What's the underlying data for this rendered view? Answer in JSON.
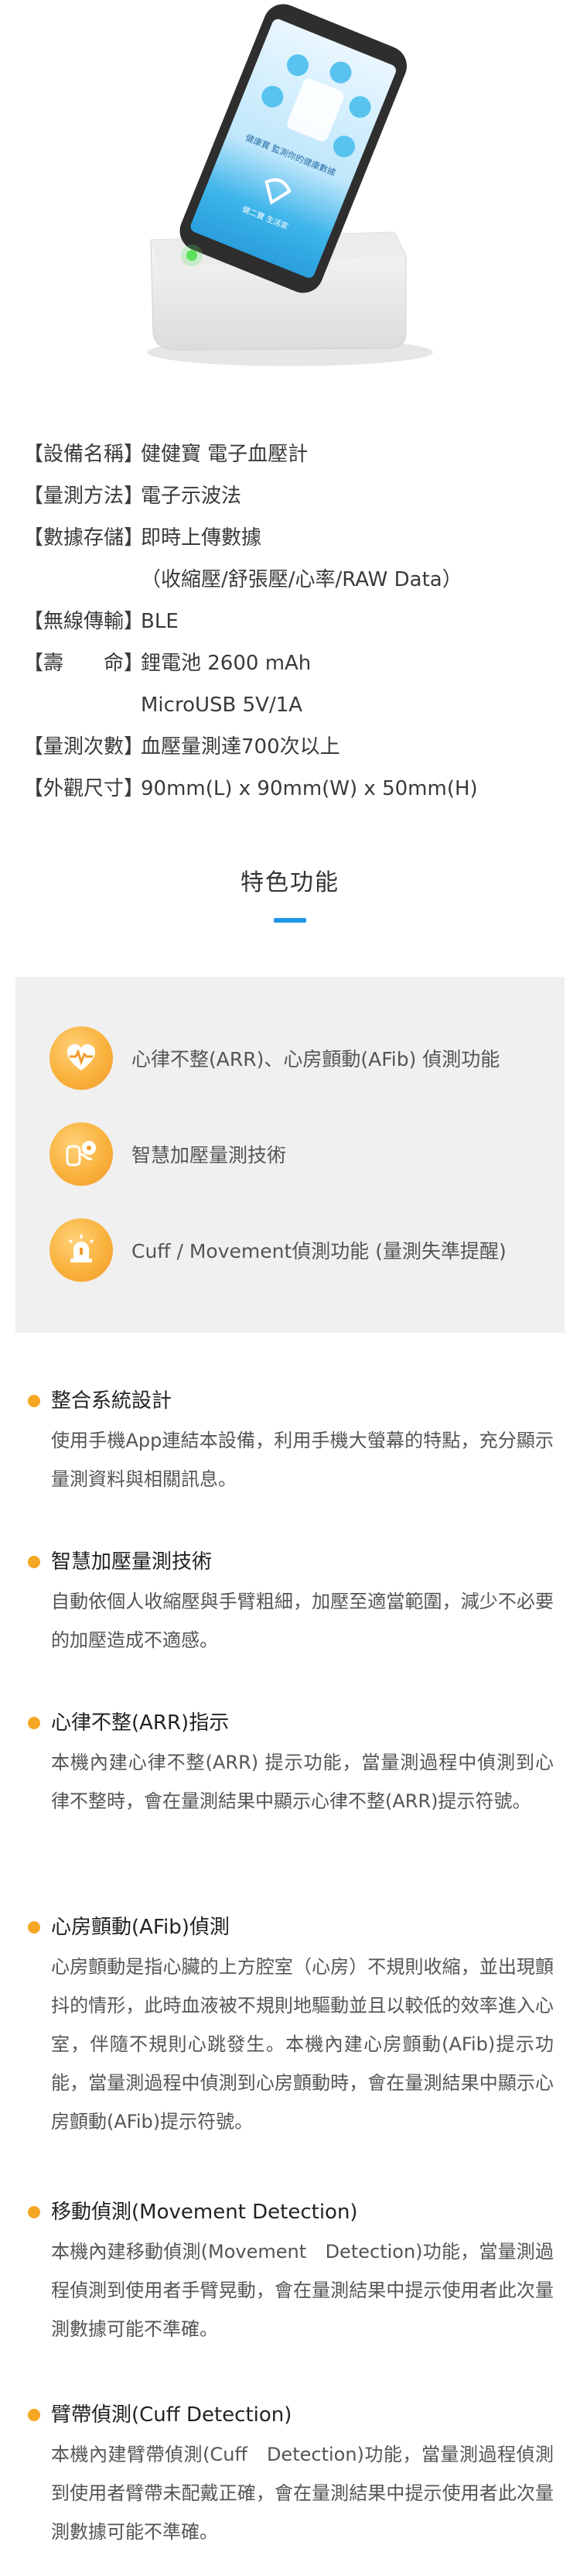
{
  "hero": {
    "phone_screen_text": "健康寶 監測你的健康數據",
    "phone_brand": "健二寶 生活家",
    "icon_names": [
      "heart-bubble-icon",
      "chart-bubble-icon",
      "calendar-bubble-icon",
      "person-bubble-icon",
      "bell-bubble-icon",
      "clipboard-bubble-icon"
    ]
  },
  "specs": [
    {
      "label": "【設備名稱】",
      "lines": [
        "健健寶 電子血壓計"
      ]
    },
    {
      "label": "【量測方法】",
      "lines": [
        "電子示波法"
      ]
    },
    {
      "label": "【數據存儲】",
      "lines": [
        "即時上傳數據",
        "（收縮壓/舒張壓/心率/RAW Data）"
      ]
    },
    {
      "label": "【無線傳輸】",
      "lines": [
        "BLE"
      ]
    },
    {
      "label": "【壽　　命】",
      "lines": [
        "鋰電池 2600 mAh",
        "MicroUSB 5V/1A"
      ]
    },
    {
      "label": "【量測次數】",
      "lines": [
        "血壓量測達700次以上"
      ]
    },
    {
      "label": "【外觀尺寸】",
      "lines": [
        "90mm(L) x 90mm(W) x 50mm(H)"
      ]
    }
  ],
  "features": {
    "title": "特色功能",
    "items": [
      {
        "icon": "heart-pulse-icon",
        "text": "心律不整(ARR)、心房顫動(AFib) 偵測功能"
      },
      {
        "icon": "arm-cuff-icon",
        "text": "智慧加壓量測技術"
      },
      {
        "icon": "alert-light-icon",
        "text": "Cuff / Movement偵測功能 (量測失準提醒)"
      }
    ]
  },
  "sections": [
    {
      "title": "整合系統設計",
      "body": "使用手機App連結本設備，利用手機大螢幕的特點，充分顯示量測資料與相關訊息。"
    },
    {
      "title": "智慧加壓量測技術",
      "body": "自動依個人收縮壓與手臂粗細，加壓至適當範圍，減少不必要的加壓造成不適感。"
    },
    {
      "title": "心律不整(ARR)指示",
      "body": "本機內建心律不整(ARR) 提示功能，當量測過程中偵測到心律不整時，會在量測結果中顯示心律不整(ARR)提示符號。"
    },
    {
      "title": "心房顫動(AFib)偵測",
      "body": "心房顫動是指心臟的上方腔室（心房）不規則收縮，並出現顫抖的情形，此時血液被不規則地驅動並且以較低的效率進入心室，伴隨不規則心跳發生。本機內建心房顫動(AFib)提示功能，當量測過程中偵測到心房顫動時，會在量測結果中顯示心房顫動(AFib)提示符號。"
    },
    {
      "title": "移動偵測(Movement Detection)",
      "body": "本機內建移動偵測(Movement　Detection)功能，當量測過程偵測到使用者手臂晃動，會在量測結果中提示使用者此次量測數據可能不準確。"
    },
    {
      "title": "臂帶偵測(Cuff Detection)",
      "body": "本機內建臂帶偵測(Cuff　Detection)功能，當量測過程偵測到使用者臂帶未配戴正確，會在量測結果中提示使用者此次量測數據可能不準確。"
    }
  ]
}
